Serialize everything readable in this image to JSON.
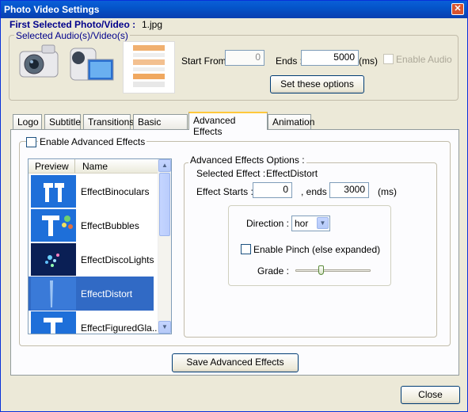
{
  "window": {
    "title": "Photo Video Settings"
  },
  "header": {
    "first_selected_label": "First Selected Photo/Video :",
    "first_selected_value": "1.jpg",
    "selected_group_label": "Selected Audio(s)/Video(s)",
    "start_from_label": "Start From :",
    "start_from_value": "0",
    "ends_label": "Ends :",
    "ends_value": "5000",
    "ends_unit": "(ms)",
    "enable_audio_label": "Enable Audio",
    "set_options_button": "Set these options"
  },
  "tabs": [
    {
      "label": "Logo"
    },
    {
      "label": "Subtitle"
    },
    {
      "label": "Transitions"
    },
    {
      "label": "Basic Effects"
    },
    {
      "label": "Advanced Effects",
      "active": true
    },
    {
      "label": "Animation"
    }
  ],
  "advanced": {
    "enable_label": "Enable Advanced Effects",
    "list_headers": [
      "Preview",
      "Name"
    ],
    "effects": [
      {
        "name": "EffectBinoculars"
      },
      {
        "name": "EffectBubbles"
      },
      {
        "name": "EffectDiscoLights"
      },
      {
        "name": "EffectDistort",
        "selected": true
      },
      {
        "name": "EffectFiguredGla..."
      }
    ],
    "options_title": "Advanced Effects Options :",
    "selected_effect_label": "Selected Effect :",
    "selected_effect_value": "EffectDistort",
    "effect_starts_label": "Effect Starts :",
    "effect_starts_value": "0",
    "ends_label": ", ends :",
    "ends_value": "3000",
    "ends_unit": "(ms)",
    "direction_label": "Direction :",
    "direction_value": "hor",
    "enable_pinch_label": "Enable Pinch (else expanded)",
    "grade_label": "Grade :",
    "grade_level": 0.33,
    "save_button": "Save Advanced Effects"
  },
  "footer": {
    "close_button": "Close"
  },
  "colors": {
    "title_bar": "#0454c9",
    "selection": "#316ac5",
    "label_blue": "#00008b",
    "active_tab_accent": "#ffc83c"
  }
}
